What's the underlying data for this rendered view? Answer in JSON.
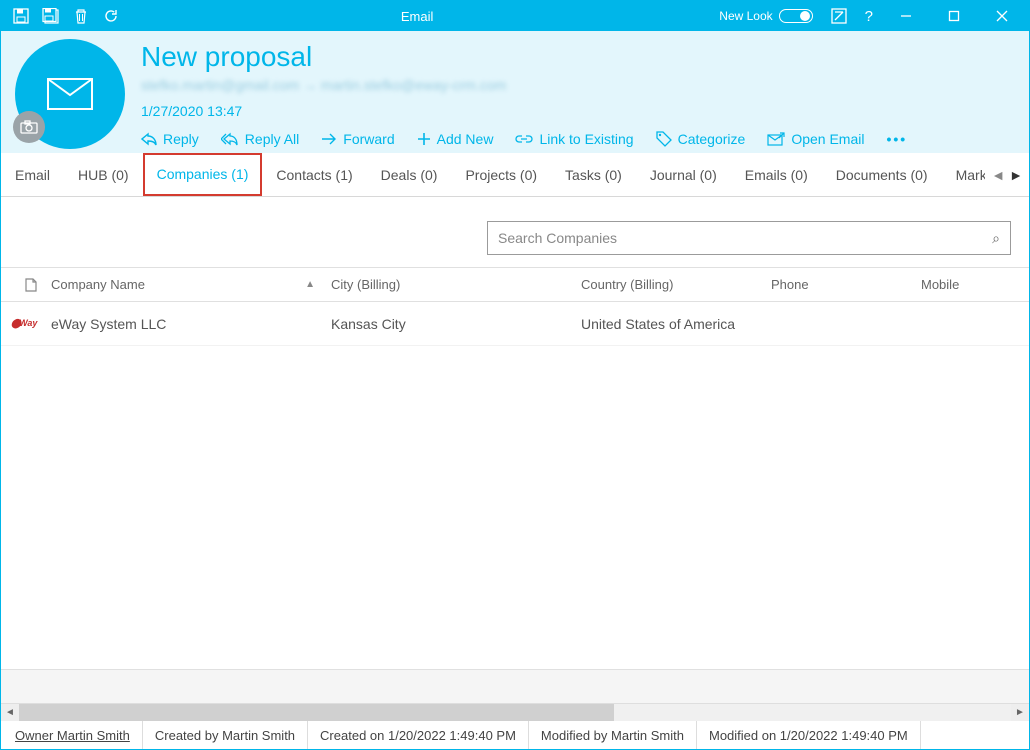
{
  "window": {
    "title": "Email",
    "new_look_label": "New Look"
  },
  "header": {
    "subject": "New proposal",
    "addresses": "stefko.martin@gmail.com → martin.stefko@eway-crm.com",
    "timestamp": "1/27/2020 13:47"
  },
  "actions": {
    "reply": "Reply",
    "reply_all": "Reply All",
    "forward": "Forward",
    "add_new": "Add New",
    "link_existing": "Link to Existing",
    "categorize": "Categorize",
    "open_email": "Open Email"
  },
  "tabs": [
    {
      "label": "Email"
    },
    {
      "label": "HUB (0)"
    },
    {
      "label": "Companies (1)",
      "active": true
    },
    {
      "label": "Contacts (1)"
    },
    {
      "label": "Deals (0)"
    },
    {
      "label": "Projects (0)"
    },
    {
      "label": "Tasks (0)"
    },
    {
      "label": "Journal (0)"
    },
    {
      "label": "Emails (0)"
    },
    {
      "label": "Documents (0)"
    },
    {
      "label": "Marketing"
    }
  ],
  "search": {
    "placeholder": "Search Companies"
  },
  "grid": {
    "columns": {
      "company": "Company Name",
      "city": "City (Billing)",
      "country": "Country (Billing)",
      "phone": "Phone",
      "mobile": "Mobile"
    },
    "rows": [
      {
        "logo": "Way",
        "company": "eWay System LLC",
        "city": "Kansas City",
        "country": "United States of America",
        "phone": "",
        "mobile": ""
      }
    ]
  },
  "status": {
    "owner": "Owner Martin Smith",
    "created_by": "Created by Martin Smith",
    "created_on": "Created on 1/20/2022 1:49:40 PM",
    "modified_by": "Modified by Martin Smith",
    "modified_on": "Modified on 1/20/2022 1:49:40 PM"
  }
}
